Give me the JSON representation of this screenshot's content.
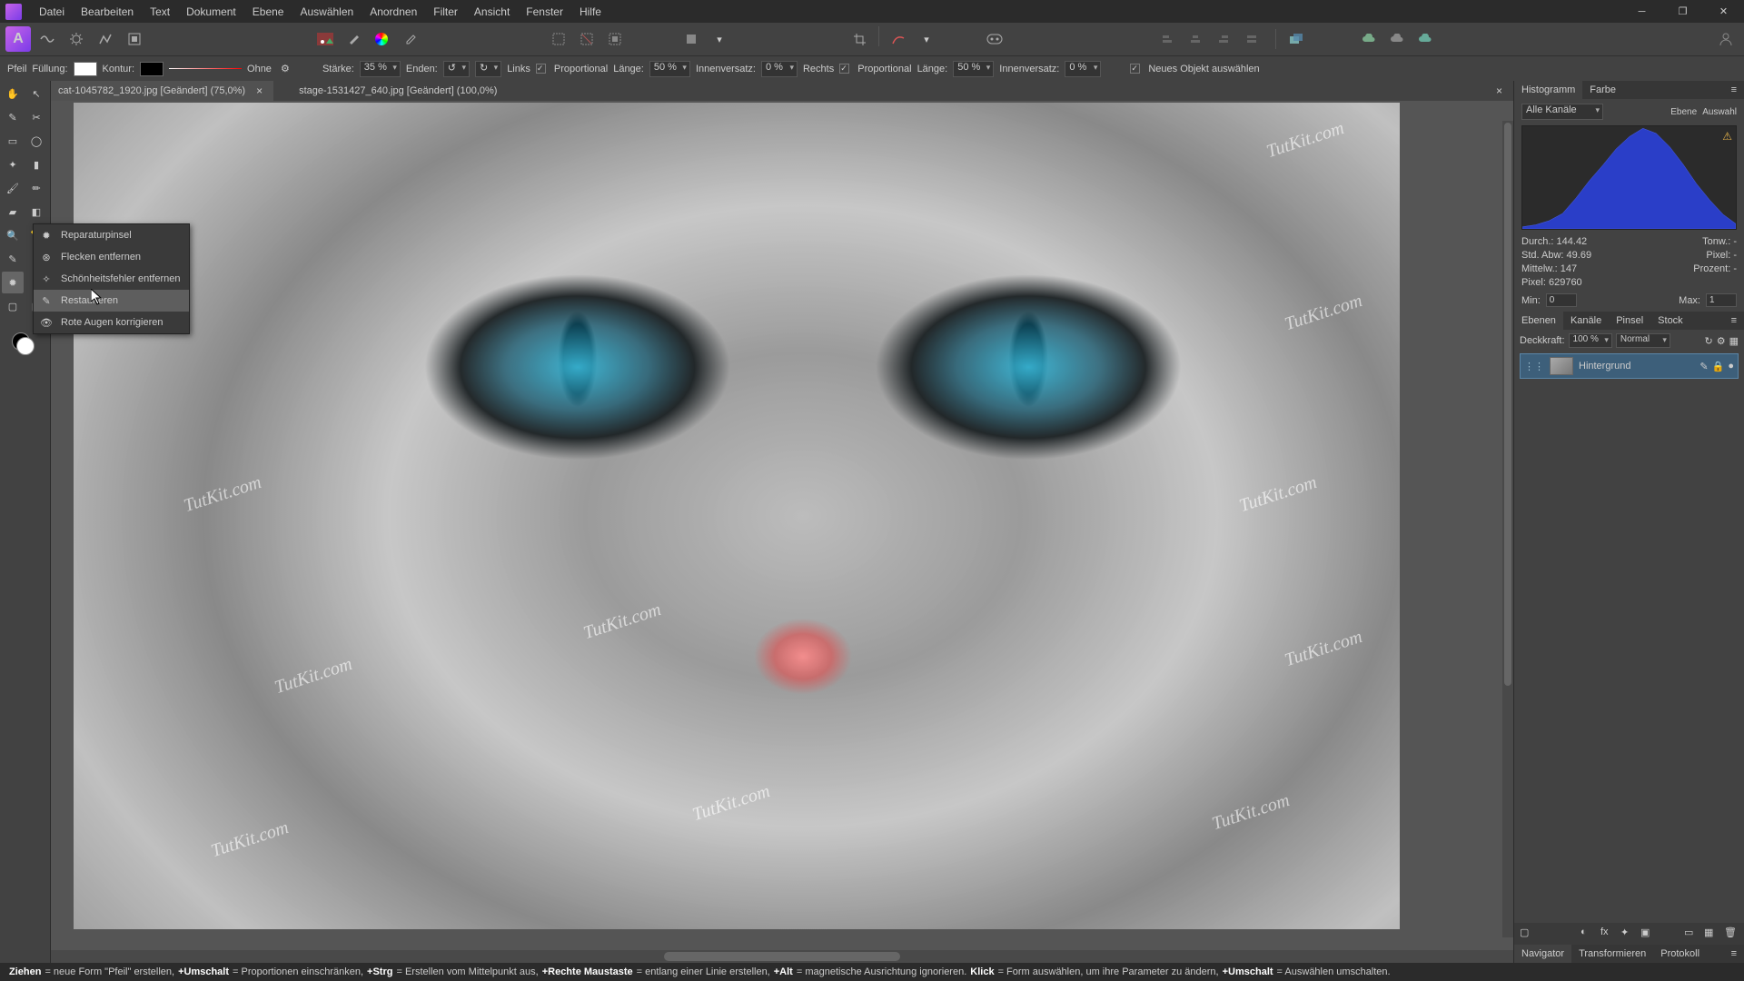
{
  "menu": [
    "Datei",
    "Bearbeiten",
    "Text",
    "Dokument",
    "Ebene",
    "Auswählen",
    "Anordnen",
    "Filter",
    "Ansicht",
    "Fenster",
    "Hilfe"
  ],
  "ctx": {
    "pfeil": "Pfeil",
    "fuellung": "Füllung:",
    "kontur": "Kontur:",
    "ohne": "Ohne",
    "staerke_l": "Stärke:",
    "staerke_v": "35 %",
    "enden": "Enden:",
    "links": "Links",
    "prop": "Proportional",
    "laenge_l": "Länge:",
    "laenge_v": "50 %",
    "inner_l": "Innenversatz:",
    "inner_v": "0 %",
    "rechts": "Rechts",
    "laenge2_v": "50 %",
    "inner2_v": "0 %",
    "neu": "Neues Objekt auswählen"
  },
  "tabs": [
    {
      "label": "cat-1045782_1920.jpg [Geändert] (75,0%)",
      "active": true
    },
    {
      "label": "stage-1531427_640.jpg [Geändert] (100,0%)",
      "active": false
    }
  ],
  "flyout": [
    "Reparaturpinsel",
    "Flecken entfernen",
    "Schönheitsfehler entfernen",
    "Restaurieren",
    "Rote Augen korrigieren"
  ],
  "flyout_hov": 3,
  "watermark": "TutKit.com",
  "rpanel": {
    "tabs1": [
      "Histogramm",
      "Farbe"
    ],
    "channels": "Alle Kanäle",
    "ebene": "Ebene",
    "auswahl": "Auswahl",
    "stats": {
      "durch_l": "Durch.:",
      "durch_v": "144.42",
      "std_l": "Std. Abw:",
      "std_v": "49.69",
      "mittel_l": "Mittelw.:",
      "mittel_v": "147",
      "pixel_l": "Pixel:",
      "pixel_v": "629760",
      "tonw_l": "Tonw.:",
      "tonw_v": "-",
      "px_l": "Pixel:",
      "px_v": "-",
      "proz_l": "Prozent:",
      "proz_v": "-"
    },
    "min_l": "Min:",
    "min_v": "0",
    "max_l": "Max:",
    "max_v": "1",
    "tabs2": [
      "Ebenen",
      "Kanäle",
      "Pinsel",
      "Stock"
    ],
    "deck_l": "Deckkraft:",
    "deck_v": "100 %",
    "blend": "Normal",
    "layer": "Hintergrund",
    "tabs3": [
      "Navigator",
      "Transformieren",
      "Protokoll"
    ]
  },
  "status": {
    "ziehen_l": "Ziehen",
    "ziehen_t": " = neue Form \"Pfeil\" erstellen, ",
    "um_l": "+Umschalt",
    "um_t": " = Proportionen einschränken, ",
    "strg_l": "+Strg",
    "strg_t": " = Erstellen vom Mittelpunkt aus, ",
    "rm_l": "+Rechte Maustaste",
    "rm_t": " = entlang einer Linie erstellen, ",
    "alt_l": "+Alt",
    "alt_t": " = magnetische Ausrichtung ignorieren. ",
    "klick_l": "Klick",
    "klick_t": " = Form auswählen, um ihre Parameter zu ändern, ",
    "um2_l": "+Umschalt",
    "um2_t": " = Auswählen umschalten."
  },
  "chart_data": {
    "type": "area",
    "title": "Histogramm",
    "xlabel": "",
    "ylabel": "",
    "xlim": [
      0,
      255
    ],
    "ylim": [
      0,
      1
    ],
    "x": [
      0,
      16,
      32,
      48,
      64,
      80,
      96,
      112,
      128,
      144,
      160,
      176,
      192,
      208,
      224,
      240,
      255
    ],
    "values": [
      0.02,
      0.04,
      0.08,
      0.15,
      0.3,
      0.47,
      0.62,
      0.78,
      0.9,
      0.98,
      0.93,
      0.8,
      0.63,
      0.44,
      0.28,
      0.14,
      0.05
    ],
    "fill": "#2a3ec8"
  }
}
